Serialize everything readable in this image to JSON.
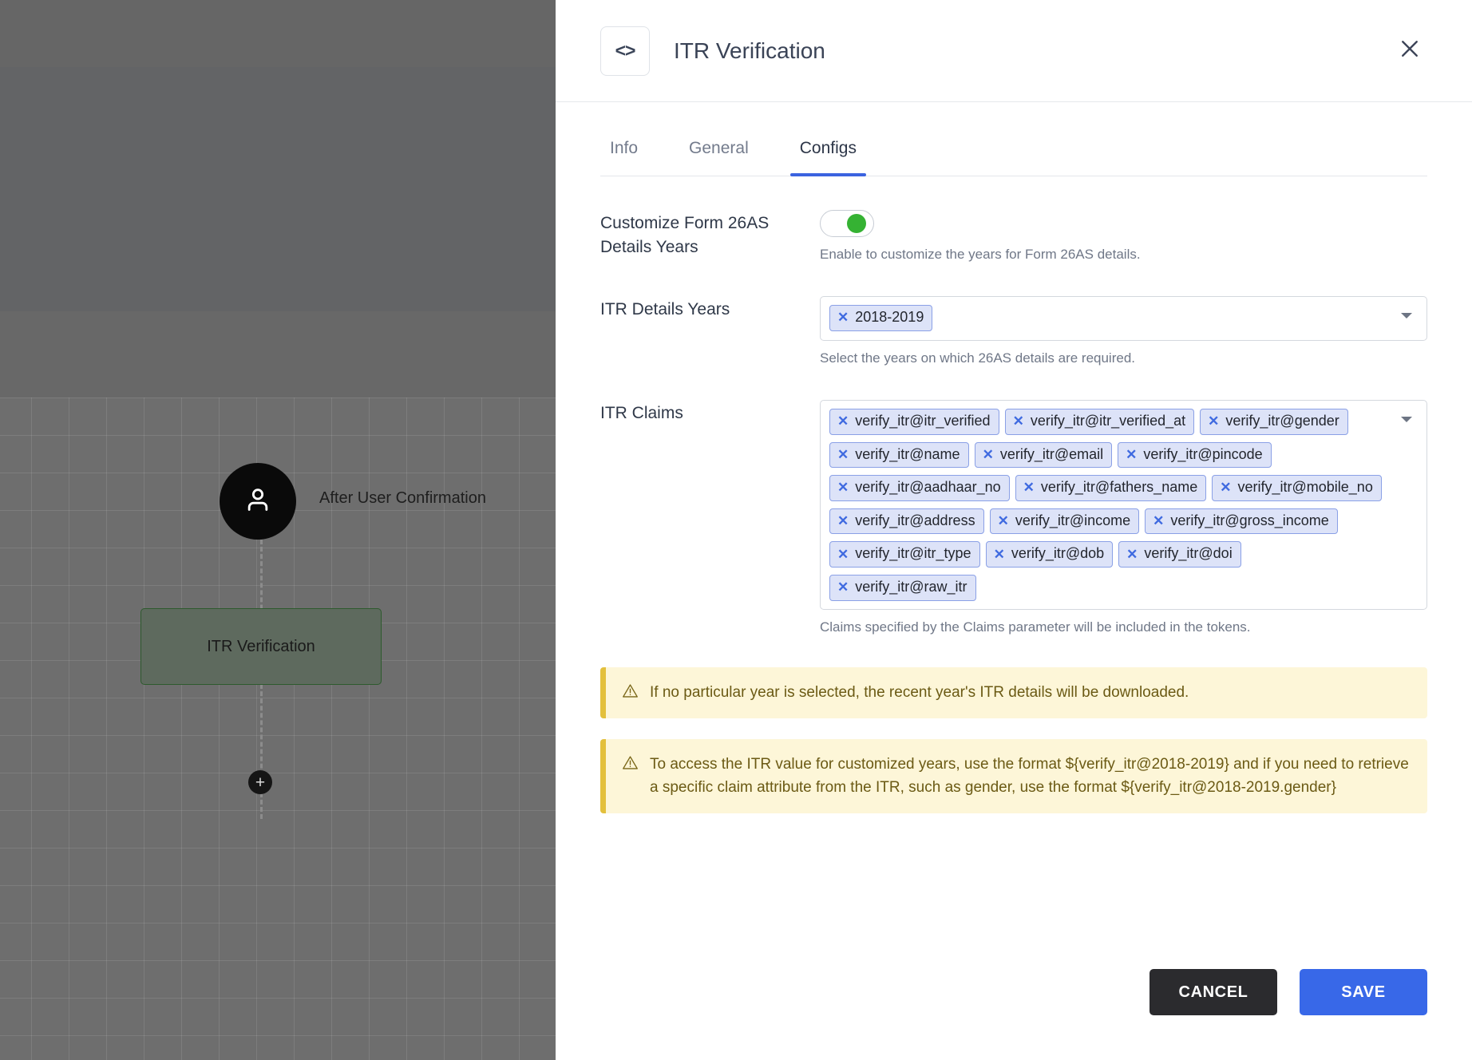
{
  "canvas": {
    "user_node": {
      "icon": "user-icon",
      "label": "After User Confirmation"
    },
    "step_node": {
      "label": "ITR Verification"
    },
    "add_button": {
      "icon": "plus-icon",
      "label": "+"
    }
  },
  "panel": {
    "header": {
      "icon": "code-brackets-icon",
      "icon_glyph": "<>",
      "title": "ITR Verification",
      "close_icon": "close-icon"
    },
    "tabs": [
      {
        "label": "Info",
        "active": false
      },
      {
        "label": "General",
        "active": false
      },
      {
        "label": "Configs",
        "active": true
      }
    ],
    "fields": {
      "customize_years": {
        "label": "Customize Form 26AS Details Years",
        "toggle_on": true,
        "hint": "Enable to customize the years for Form 26AS details."
      },
      "itr_details_years": {
        "label": "ITR Details Years",
        "chips": [
          "2018-2019"
        ],
        "hint": "Select the years on which 26AS details are required.",
        "caret_icon": "chevron-down-icon"
      },
      "itr_claims": {
        "label": "ITR Claims",
        "chips": [
          "verify_itr@itr_verified",
          "verify_itr@itr_verified_at",
          "verify_itr@gender",
          "verify_itr@name",
          "verify_itr@email",
          "verify_itr@pincode",
          "verify_itr@aadhaar_no",
          "verify_itr@fathers_name",
          "verify_itr@mobile_no",
          "verify_itr@address",
          "verify_itr@income",
          "verify_itr@gross_income",
          "verify_itr@itr_type",
          "verify_itr@dob",
          "verify_itr@doi",
          "verify_itr@raw_itr"
        ],
        "hint": "Claims specified by the Claims parameter will be included in the tokens.",
        "caret_icon": "chevron-down-icon"
      }
    },
    "banners": [
      {
        "icon": "warning-triangle-icon",
        "text": "If no particular year is selected, the recent year's ITR details will be downloaded."
      },
      {
        "icon": "warning-triangle-icon",
        "text": "To access the ITR value for customized years, use the format ${verify_itr@2018-2019} and if you need to retrieve a specific claim attribute from the ITR, such as gender, use the format ${verify_itr@2018-2019.gender}"
      }
    ],
    "footer": {
      "cancel_label": "CANCEL",
      "save_label": "SAVE"
    }
  },
  "colors": {
    "accent_blue": "#3868e8",
    "tab_underline": "#3b63e0",
    "toggle_on": "#35b233",
    "chip_bg": "#dde3f8",
    "chip_border": "#8aa0e6",
    "banner_bg": "#fdf6d8",
    "banner_border": "#e3c03c",
    "cancel_bg": "#2b2b2e",
    "node_box_bg": "#5e6a5e",
    "node_box_border": "#2d5a2d"
  }
}
